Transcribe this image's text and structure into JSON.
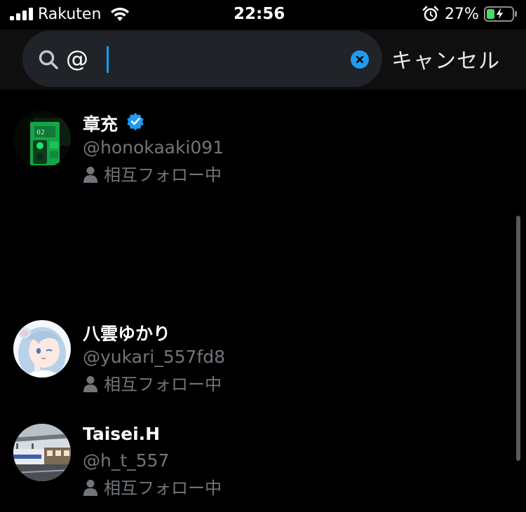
{
  "status_bar": {
    "carrier": "Rakuten",
    "time": "22:56",
    "battery_percent": "27%"
  },
  "search": {
    "query": "@",
    "cancel_label": "キャンセル"
  },
  "results": [
    {
      "display_name": "章充",
      "verified": true,
      "handle": "@honokaaki091",
      "follow_status": "相互フォロー中",
      "avatar": "green-signal-photo"
    },
    {
      "display_name": "八雲ゆかり",
      "verified": false,
      "handle": "@yukari_557fd8",
      "follow_status": "相互フォロー中",
      "avatar": "anime-girl-illustration"
    },
    {
      "display_name": "Taisei.H",
      "verified": false,
      "handle": "@h_t_557",
      "follow_status": "相互フォロー中",
      "avatar": "train-station-photo"
    }
  ],
  "colors": {
    "accent": "#1d9bf0",
    "background": "#000000",
    "secondary_text": "#71767b",
    "battery_charging": "#4cd964"
  }
}
